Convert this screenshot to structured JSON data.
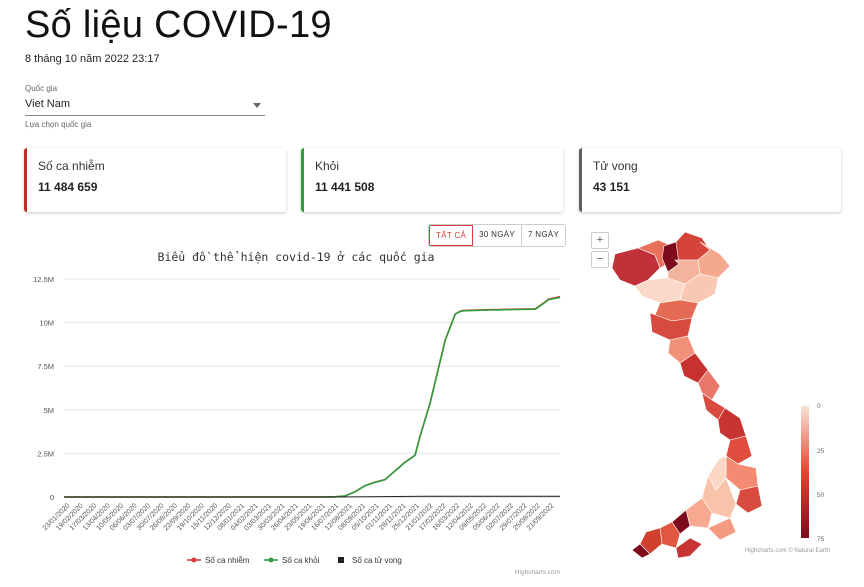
{
  "header": {
    "title": "Số liệu COVID-19",
    "timestamp": "8 tháng 10 năm 2022 23:17"
  },
  "country_select": {
    "label": "Quốc gia",
    "value": "Viet Nam",
    "hint": "Lựa chọn quốc gia"
  },
  "cards": [
    {
      "label": "Số ca nhiễm",
      "value": "11 484 659",
      "color": "#c62828"
    },
    {
      "label": "Khỏi",
      "value": "11 441 508",
      "color": "#2e9e3e"
    },
    {
      "label": "Tử vong",
      "value": "43 151",
      "color": "#616161"
    }
  ],
  "range_buttons": [
    {
      "label": "TẤT CẢ",
      "active": true
    },
    {
      "label": "30 NGÀY",
      "active": false
    },
    {
      "label": "7 NGÀY",
      "active": false
    }
  ],
  "chart_data": {
    "type": "line",
    "title": "Biểu đồ thể hiện covid-19 ở các quốc gia",
    "xlabel": "",
    "ylabel": "",
    "ylim": [
      0,
      12500000
    ],
    "y_ticks": [
      0,
      2500000,
      5000000,
      7500000,
      10000000,
      12500000
    ],
    "y_tick_labels": [
      "0",
      "2.5M",
      "5M",
      "7.5M",
      "10M",
      "12.5M"
    ],
    "x_tick_labels": [
      "23/01/2020",
      "19/02/2020",
      "17/03/2020",
      "13/04/2020",
      "10/05/2020",
      "06/06/2020",
      "03/07/2020",
      "30/07/2020",
      "26/08/2020",
      "22/09/2020",
      "19/10/2020",
      "15/11/2020",
      "12/12/2020",
      "08/01/2021",
      "04/02/2021",
      "03/03/2021",
      "30/03/2021",
      "26/04/2021",
      "23/05/2021",
      "19/06/2021",
      "16/07/2021",
      "12/08/2021",
      "08/09/2021",
      "05/10/2021",
      "01/11/2021",
      "28/11/2021",
      "25/12/2021",
      "21/01/2022",
      "17/02/2022",
      "16/03/2022",
      "12/04/2022",
      "09/05/2022",
      "05/06/2022",
      "02/07/2022",
      "29/07/2022",
      "25/08/2022",
      "21/09/2022"
    ],
    "x_range_days": [
      0,
      989
    ],
    "grid": true,
    "legend_position": "bottom",
    "series": [
      {
        "name": "Số ca nhiễm",
        "color": "#d33b3b",
        "x_days": [
          0,
          500,
          540,
          560,
          580,
          600,
          620,
          640,
          660,
          680,
          700,
          710,
          730,
          760,
          780,
          790,
          793,
          800,
          820,
          850,
          870,
          880,
          900,
          940,
          960,
          966,
          989
        ],
        "values": [
          0,
          0,
          10000,
          60000,
          300000,
          650000,
          850000,
          1000000,
          1500000,
          2000000,
          2400000,
          3500000,
          5400000,
          9000000,
          10500000,
          10650000,
          10680000,
          10700000,
          10720000,
          10740000,
          10750000,
          10760000,
          10770000,
          10790000,
          11200000,
          11350000,
          11484659
        ]
      },
      {
        "name": "Số ca khỏi",
        "color": "#2e9e3e",
        "x_days": [
          0,
          500,
          540,
          560,
          580,
          600,
          620,
          640,
          660,
          680,
          700,
          710,
          730,
          760,
          780,
          790,
          793,
          800,
          820,
          850,
          870,
          880,
          900,
          940,
          960,
          966,
          989
        ],
        "values": [
          0,
          0,
          9000,
          55000,
          290000,
          640000,
          840000,
          990000,
          1490000,
          1990000,
          2390000,
          3480000,
          5380000,
          8980000,
          10480000,
          10630000,
          10660000,
          10680000,
          10700000,
          10720000,
          10730000,
          10740000,
          10750000,
          10770000,
          11180000,
          11320000,
          11441508
        ]
      },
      {
        "name": "Số ca tử vong",
        "color": "#222222",
        "x_days": [
          0,
          540,
          600,
          660,
          720,
          800,
          900,
          989
        ],
        "values": [
          0,
          100,
          20000,
          30000,
          38000,
          42000,
          43000,
          43151
        ]
      }
    ]
  },
  "map": {
    "zoom_in": "+",
    "zoom_out": "−",
    "color_min": "#fbe3d6",
    "color_max": "#7d0a1d",
    "legend_labels": [
      "0",
      "25",
      "50",
      "75"
    ],
    "credits": "Highcharts.com © Natural Earth"
  },
  "chart_credits": "Highcharts.com"
}
